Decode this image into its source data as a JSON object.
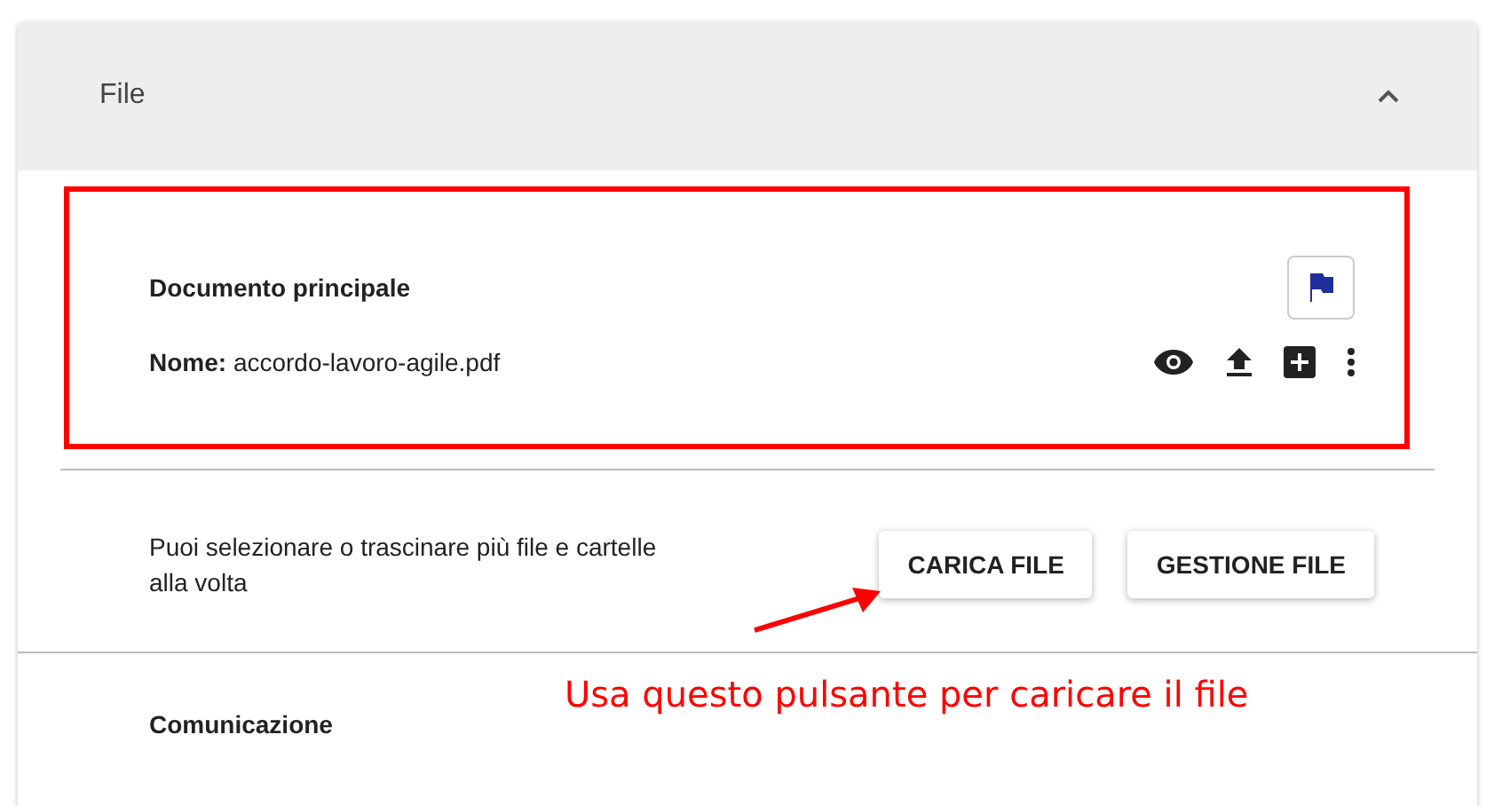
{
  "panel": {
    "title": "File",
    "expanded": true
  },
  "document": {
    "heading": "Documento principale",
    "name_label": "Nome:",
    "name_value": "accordo-lavoro-agile.pdf"
  },
  "upload": {
    "hint": "Puoi selezionare o trascinare più file e cartelle alla volta",
    "buttons": [
      "CARICA FILE",
      "GESTIONE FILE"
    ]
  },
  "next_section": {
    "heading": "Comunicazione"
  },
  "annotation": {
    "text": "Usa questo pulsante per caricare il file"
  }
}
